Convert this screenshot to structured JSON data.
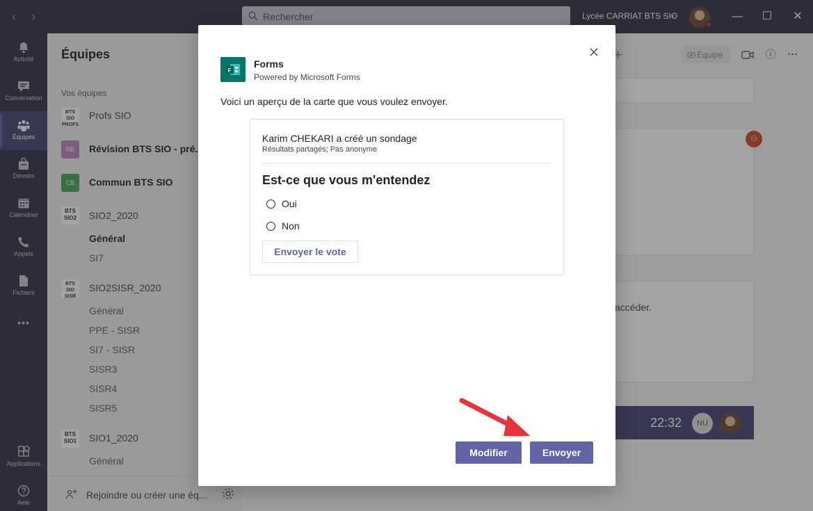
{
  "titlebar": {
    "search_placeholder": "Rechercher",
    "org_name": "Lycée CARRIAT BTS SIO",
    "back": "‹",
    "forward": "›",
    "chevron": "⌄",
    "minimize": "—",
    "maximize": "☐",
    "close": "✕"
  },
  "rail": {
    "items": [
      {
        "label": "Activité",
        "icon": "bell-icon"
      },
      {
        "label": "Conversation",
        "icon": "chat-icon"
      },
      {
        "label": "Équipes",
        "icon": "teams-icon"
      },
      {
        "label": "Devoirs",
        "icon": "assignments-icon"
      },
      {
        "label": "Calendrier",
        "icon": "calendar-icon"
      },
      {
        "label": "Appels",
        "icon": "phone-icon"
      },
      {
        "label": "Fichiers",
        "icon": "file-icon"
      }
    ],
    "more": "•••",
    "applications": "Applications",
    "help": "Aide"
  },
  "teams": {
    "title": "Équipes",
    "section": "Vos équipes",
    "list": [
      {
        "logo": "BTS SIO PROFS",
        "name": "Profs SIO"
      },
      {
        "logo": "RB",
        "name": "Révision BTS SIO - pré..."
      },
      {
        "logo": "CB",
        "name": "Commun BTS SIO"
      },
      {
        "logo": "BTS SIO2",
        "name": "SIO2_2020"
      },
      {
        "logo": "BTS SIO SISR",
        "name": "SIO2SISR_2020"
      },
      {
        "logo": "BTS SIO1",
        "name": "SIO1_2020"
      }
    ],
    "channels_sio2": [
      "Général",
      "SI7"
    ],
    "channels_sisr": [
      "Général",
      "PPE - SISR",
      "SI7 - SISR",
      "SISR3",
      "SISR4",
      "SISR5"
    ],
    "channels_sio1": [
      "Général"
    ],
    "join_text": "Rejoindre ou créer une éq..."
  },
  "main": {
    "team_chip": "Équipe",
    "bg_text": "accéder.",
    "meeting_time": "22:32",
    "nu_initials": "NU",
    "plus": "+",
    "more": "···",
    "info": "ⓘ"
  },
  "dialog": {
    "app_name": "Forms",
    "app_subtitle": "Powered by Microsoft Forms",
    "preview_text": "Voici un aperçu de la carte que vous voulez envoyer.",
    "card": {
      "author_line": "Karim CHEKARI a créé un sondage",
      "meta_line": "Résultats partagés; Pas anonyme",
      "question": "Est-ce que vous m'entendez",
      "options": [
        "Oui",
        "Non"
      ],
      "vote_button": "Envoyer le vote"
    },
    "buttons": {
      "modify": "Modifier",
      "send": "Envoyer"
    }
  },
  "colors": {
    "brand": "#6264a7",
    "rail": "#33344a",
    "forms_green": "#077568",
    "arrow_red": "#e8333a"
  }
}
